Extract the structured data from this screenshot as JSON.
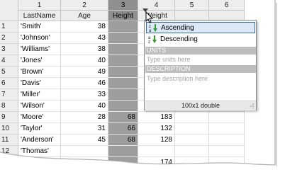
{
  "columns": [
    {
      "number": "1",
      "name": "LastName"
    },
    {
      "number": "2",
      "name": "Age"
    },
    {
      "number": "3",
      "name": "Height"
    },
    {
      "number": "4",
      "name": "Weight"
    },
    {
      "number": "5",
      "name": ""
    },
    {
      "number": "6",
      "name": ""
    }
  ],
  "rows": [
    {
      "n": "1",
      "last": "'Smith'",
      "age": "38",
      "height": "",
      "weight": ""
    },
    {
      "n": "2",
      "last": "'Johnson'",
      "age": "43",
      "height": "",
      "weight": ""
    },
    {
      "n": "3",
      "last": "'Williams'",
      "age": "38",
      "height": "",
      "weight": ""
    },
    {
      "n": "4",
      "last": "'Jones'",
      "age": "40",
      "height": "",
      "weight": ""
    },
    {
      "n": "5",
      "last": "'Brown'",
      "age": "49",
      "height": "",
      "weight": ""
    },
    {
      "n": "6",
      "last": "'Davis'",
      "age": "46",
      "height": "",
      "weight": ""
    },
    {
      "n": "7",
      "last": "'Miller'",
      "age": "33",
      "height": "",
      "weight": ""
    },
    {
      "n": "8",
      "last": "'Wilson'",
      "age": "40",
      "height": "",
      "weight": ""
    },
    {
      "n": "9",
      "last": "'Moore'",
      "age": "28",
      "height": "68",
      "weight": "183"
    },
    {
      "n": "10",
      "last": "'Taylor'",
      "age": "31",
      "height": "66",
      "weight": "132"
    },
    {
      "n": "11",
      "last": "'Anderson'",
      "age": "45",
      "height": "68",
      "weight": "128"
    },
    {
      "n": "12",
      "last": "'Thomas'",
      "age": "",
      "height": "",
      "weight": ""
    },
    {
      "n": "",
      "last": "",
      "age": "",
      "height": "",
      "weight": "174"
    }
  ],
  "menu": {
    "sort_ascending": "Ascending",
    "sort_descending": "Descending",
    "units_header": "UNITS",
    "units_placeholder": "Type units here",
    "description_header": "DESCRIPTION",
    "description_placeholder": "Type description here",
    "size_info": "100x1 double"
  },
  "colors": {
    "selected_column": "#9d9d9d",
    "menu_highlight": "#dbe9f7",
    "menu_highlight_border": "#2f6fb0",
    "section_header": "#bdbdbd",
    "sort_arrow": "#2e9b2e"
  },
  "icons": [
    "sort-ascending-icon",
    "sort-descending-icon",
    "dropdown-arrow-icon",
    "mouse-cursor-icon",
    "resize-grip-icon"
  ]
}
